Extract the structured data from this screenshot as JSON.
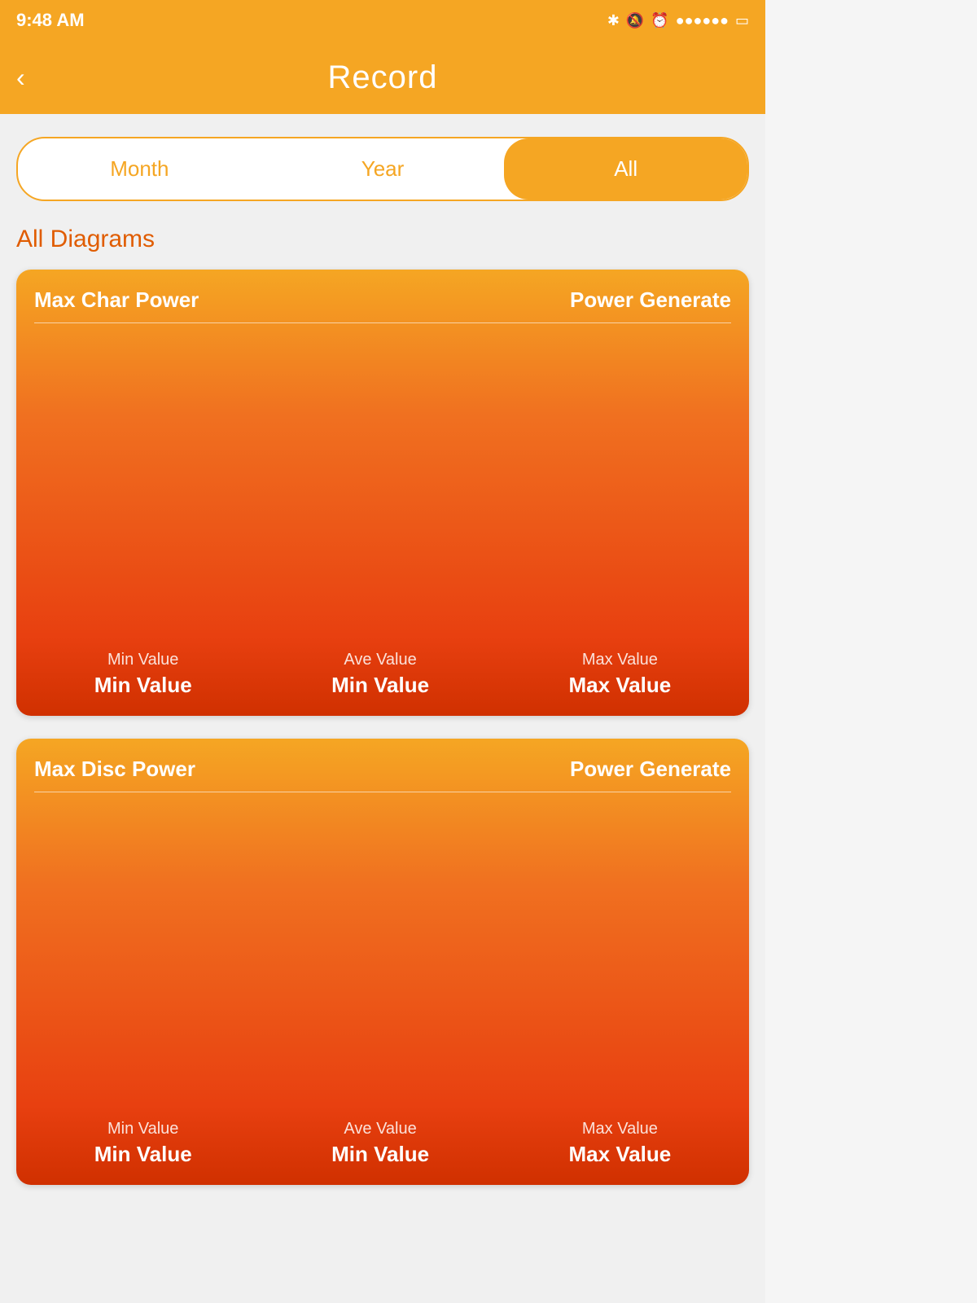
{
  "statusBar": {
    "time": "9:48 AM",
    "icons": "✱ 🔕 ⏰ ●●●●●● 🔋"
  },
  "header": {
    "backLabel": "‹",
    "title": "Record"
  },
  "tabs": [
    {
      "id": "month",
      "label": "Month",
      "active": false
    },
    {
      "id": "year",
      "label": "Year",
      "active": false
    },
    {
      "id": "all",
      "label": "All",
      "active": true
    }
  ],
  "sectionTitle": "All Diagrams",
  "diagrams": [
    {
      "id": "char-power",
      "title": "Max Char Power",
      "subtitle": "Power Generate",
      "stats": [
        {
          "label": "Min Value",
          "value": "Min Value"
        },
        {
          "label": "Ave Value",
          "value": "Min Value"
        },
        {
          "label": "Max Value",
          "value": "Max Value"
        }
      ]
    },
    {
      "id": "disc-power",
      "title": "Max Disc Power",
      "subtitle": "Power Generate",
      "stats": [
        {
          "label": "Min Value",
          "value": "Min Value"
        },
        {
          "label": "Ave Value",
          "value": "Min Value"
        },
        {
          "label": "Max Value",
          "value": "Max Value"
        }
      ]
    }
  ]
}
